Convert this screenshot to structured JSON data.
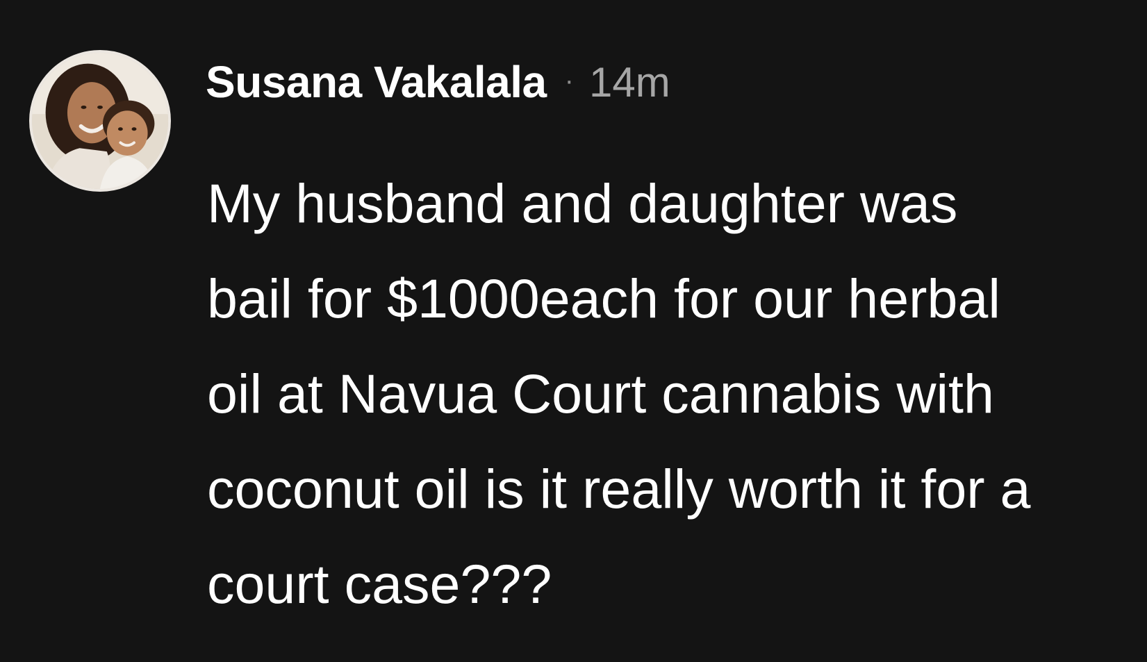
{
  "post": {
    "author": "Susana Vakalala",
    "separator": "·",
    "time": "14m",
    "avatar": "profile-photo-avatar",
    "lines": [
      "My husband and daughter was",
      "bail for $1000each for our herbal",
      "oil at Navua Court cannabis with",
      "coconut oil is it really worth it for a",
      "court case???"
    ]
  },
  "colors": {
    "background": "#141414",
    "text": "#ffffff",
    "muted": "#a6a6a6"
  }
}
